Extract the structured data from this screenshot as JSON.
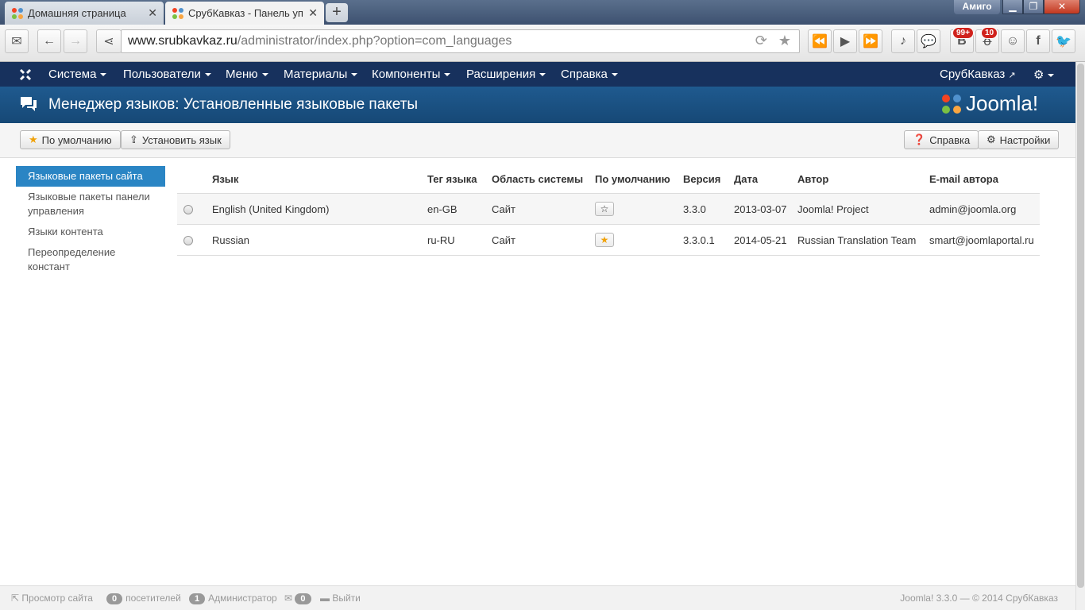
{
  "browser": {
    "tabs": [
      {
        "title": "Домашняя страница",
        "active": false
      },
      {
        "title": "СрубКавказ - Панель упра",
        "active": true
      }
    ],
    "new_tab_label": "+",
    "user": "Амиго",
    "url_host": "www.srubkavkaz.ru",
    "url_path": "/administrator/index.php?option=com_languages",
    "badges": {
      "vk": "99+",
      "ok": "10"
    }
  },
  "nav": {
    "items": [
      "Система",
      "Пользователи",
      "Меню",
      "Материалы",
      "Компоненты",
      "Расширения",
      "Справка"
    ],
    "site_link": "СрубКавказ"
  },
  "header": {
    "title": "Менеджер языков: Установленные языковые пакеты",
    "brand": "Joomla!"
  },
  "toolbar": {
    "default_label": "По умолчанию",
    "install_label": "Установить язык",
    "help_label": "Справка",
    "settings_label": "Настройки"
  },
  "sidebar": {
    "items": [
      {
        "label": "Языковые пакеты сайта",
        "active": true
      },
      {
        "label": "Языковые пакеты панели управления",
        "active": false
      },
      {
        "label": "Языки контента",
        "active": false
      },
      {
        "label": "Переопределение констант",
        "active": false
      }
    ]
  },
  "table": {
    "columns": [
      "Язык",
      "Тег языка",
      "Область системы",
      "По умолчанию",
      "Версия",
      "Дата",
      "Автор",
      "E-mail автора"
    ],
    "rows": [
      {
        "language": "English (United Kingdom)",
        "tag": "en-GB",
        "area": "Сайт",
        "is_default": false,
        "version": "3.3.0",
        "date": "2013-03-07",
        "author": "Joomla! Project",
        "email": "admin@joomla.org"
      },
      {
        "language": "Russian",
        "tag": "ru-RU",
        "area": "Сайт",
        "is_default": true,
        "version": "3.3.0.1",
        "date": "2014-05-21",
        "author": "Russian Translation Team",
        "email": "smart@joomlaportal.ru"
      }
    ]
  },
  "footer": {
    "view_site": "Просмотр сайта",
    "visitors_count": "0",
    "visitors_label": "посетителей",
    "admins_count": "1",
    "admins_label": "Администратор",
    "messages_count": "0",
    "logout": "Выйти",
    "copyright": "Joomla! 3.3.0  —  © 2014 СрубКавказ"
  },
  "colors": {
    "nav_bg": "#17315d",
    "header_bg": "#1f5a8f",
    "sidebar_active": "#2a85c4",
    "star": "#f0a20a"
  }
}
